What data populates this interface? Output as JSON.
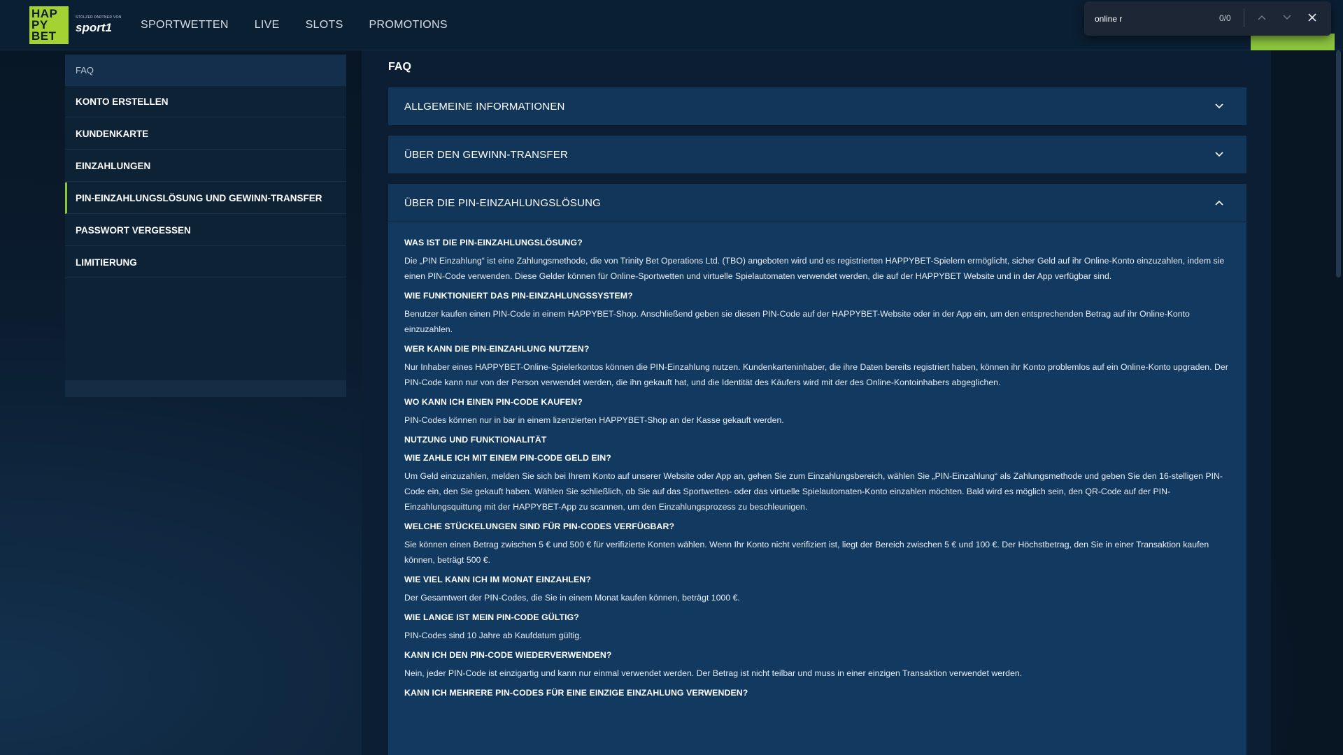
{
  "header": {
    "logo_text": [
      "HAP",
      "PY",
      "BET"
    ],
    "partner_small": "STOLZER PARTNER VON",
    "partner_brand": "sport1",
    "nav": [
      "SPORTWETTEN",
      "LIVE",
      "SLOTS",
      "PROMOTIONS"
    ]
  },
  "findbar": {
    "value": "online r",
    "count": "0/0"
  },
  "sidebar": {
    "items": [
      "FAQ",
      "KONTO ERSTELLEN",
      "KUNDENKARTE",
      "EINZAHLUNGEN",
      "PIN-EINZAHLUNGSLÖSUNG UND GEWINN-TRANSFER",
      "PASSWORT VERGESSEN",
      "LIMITIERUNG"
    ]
  },
  "main": {
    "title": "FAQ",
    "accordions": [
      "ALLGEMEINE INFORMATIONEN",
      "ÜBER DEN GEWINN-TRANSFER",
      "ÜBER DIE PIN-EINZAHLUNGSLÖSUNG"
    ],
    "content": [
      {
        "q": "WAS IST DIE PIN-EINZAHLUNGSLÖSUNG?",
        "a": "Die „PIN Einzahlung“ ist eine Zahlungsmethode, die von Trinity Bet Operations Ltd. (TBO) angeboten wird und es registrierten HAPPYBET-Spielern ermöglicht, sicher Geld auf ihr Online-Konto einzuzahlen, indem sie einen PIN-Code verwenden. Diese Gelder können für Online-Sportwetten und virtuelle Spielautomaten verwendet werden, die auf der HAPPYBET Website und in der App verfügbar sind."
      },
      {
        "q": "WIE FUNKTIONIERT DAS PIN-EINZAHLUNGSSYSTEM?",
        "a": "Benutzer kaufen einen PIN-Code in einem HAPPYBET-Shop. Anschließend geben sie diesen PIN-Code auf der HAPPYBET-Website oder in der App ein, um den entsprechenden Betrag auf ihr Online-Konto einzuzahlen."
      },
      {
        "q": "WER KANN DIE PIN-EINZAHLUNG NUTZEN?",
        "a": "Nur Inhaber eines HAPPYBET-Online-Spielerkontos können die PIN-Einzahlung nutzen. Kundenkarteninhaber, die ihre Daten bereits registriert haben, können ihr Konto problemlos auf ein Online-Konto upgraden. Der PIN-Code kann nur von der Person verwendet werden, die ihn gekauft hat, und die Identität des Käufers wird mit der des Online-Kontoinhabers abgeglichen."
      },
      {
        "q": "WO KANN ICH EINEN PIN-CODE KAUFEN?",
        "a": "PIN-Codes können nur in bar in einem lizenzierten HAPPYBET-Shop an der Kasse gekauft werden."
      },
      {
        "q": "NUTZUNG UND FUNKTIONALITÄT",
        "a": ""
      },
      {
        "q": "WIE ZAHLE ICH MIT EINEM PIN-CODE GELD EIN?",
        "a": "Um Geld einzuzahlen, melden Sie sich bei Ihrem Konto auf unserer Website oder App an, gehen Sie zum Einzahlungsbereich, wählen Sie „PIN-Einzahlung“ als Zahlungsmethode und geben Sie den 16-stelligen PIN-Code ein, den Sie gekauft haben. Wählen Sie schließlich, ob Sie auf das Sportwetten- oder das virtuelle Spielautomaten-Konto einzahlen möchten. Bald wird es möglich sein, den QR-Code auf der PIN-Einzahlungsquittung mit der HAPPYBET-App zu scannen, um den Einzahlungsprozess zu beschleunigen."
      },
      {
        "q": "WELCHE STÜCKELUNGEN SIND FÜR PIN-CODES VERFÜGBAR?",
        "a": "Sie können einen Betrag zwischen 5 € und 500 € für verifizierte Konten wählen. Wenn Ihr Konto nicht verifiziert ist, liegt der Bereich zwischen 5 € und 100 €. Der Höchstbetrag, den Sie in einer Transaktion kaufen können, beträgt 500 €."
      },
      {
        "q": "WIE VIEL KANN ICH IM MONAT EINZAHLEN?",
        "a": "Der Gesamtwert der PIN-Codes, die Sie in einem Monat kaufen können, beträgt 1000 €."
      },
      {
        "q": "WIE LANGE IST MEIN PIN-CODE GÜLTIG?",
        "a": "PIN-Codes sind 10 Jahre ab Kaufdatum gültig."
      },
      {
        "q": "KANN ICH DEN PIN-CODE WIEDERVERWENDEN?",
        "a": "Nein, jeder PIN-Code ist einzigartig und kann nur einmal verwendet werden. Der Betrag ist nicht teilbar und muss in einer einzigen Transaktion verwendet werden."
      },
      {
        "q": "KANN ICH MEHRERE PIN-CODES FÜR EINE EINZIGE EINZAHLUNG VERWENDEN?",
        "a": ""
      }
    ]
  },
  "colors": {
    "accent": "#8cc63f",
    "logo_bg": "#a4d233",
    "panel": "#12365a"
  }
}
